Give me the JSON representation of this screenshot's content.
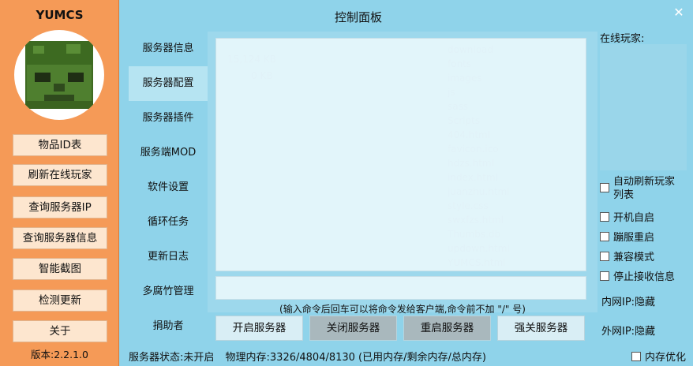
{
  "app": {
    "name": "YUMCS",
    "title": "控制面板",
    "version": "版本:2.2.1.0"
  },
  "sidebar_buttons": [
    "物品ID表",
    "刷新在线玩家",
    "查询服务器IP",
    "查询服务器信息",
    "智能截图",
    "检测更新",
    "关于"
  ],
  "nav_items": [
    "服务器信息",
    "服务器配置",
    "服务器插件",
    "服务端MOD",
    "软件设置",
    "循环任务",
    "更新日志",
    "多腐竹管理",
    "捐助者"
  ],
  "console": {
    "hint": "(输入命令后回车可以将命令发给客户端,命令前不加 \"/\" 号)",
    "output": "",
    "input": ""
  },
  "actions": [
    "开启服务器",
    "关闭服务器",
    "重启服务器",
    "强关服务器"
  ],
  "status": {
    "server_state": "服务器状态:未开启",
    "memory": "物理内存:3326/4804/8130 (已用内存/剩余内存/总内存)"
  },
  "right_panel": {
    "online_label": "在线玩家:",
    "options": [
      "自动刷新玩家列表",
      "开机自启",
      "蹦服重启",
      "兼容模式",
      "停止接收信息"
    ],
    "lan_ip": "内网IP:隐藏",
    "wan_ip": "外网IP:隐藏",
    "mem_opt": "内存优化"
  },
  "icons": {
    "close": "close-icon",
    "logo": "zombie-head-logo"
  },
  "colors": {
    "sidebar": "#f59a57",
    "background": "#8fd3ea",
    "button": "#fde6cf"
  }
}
